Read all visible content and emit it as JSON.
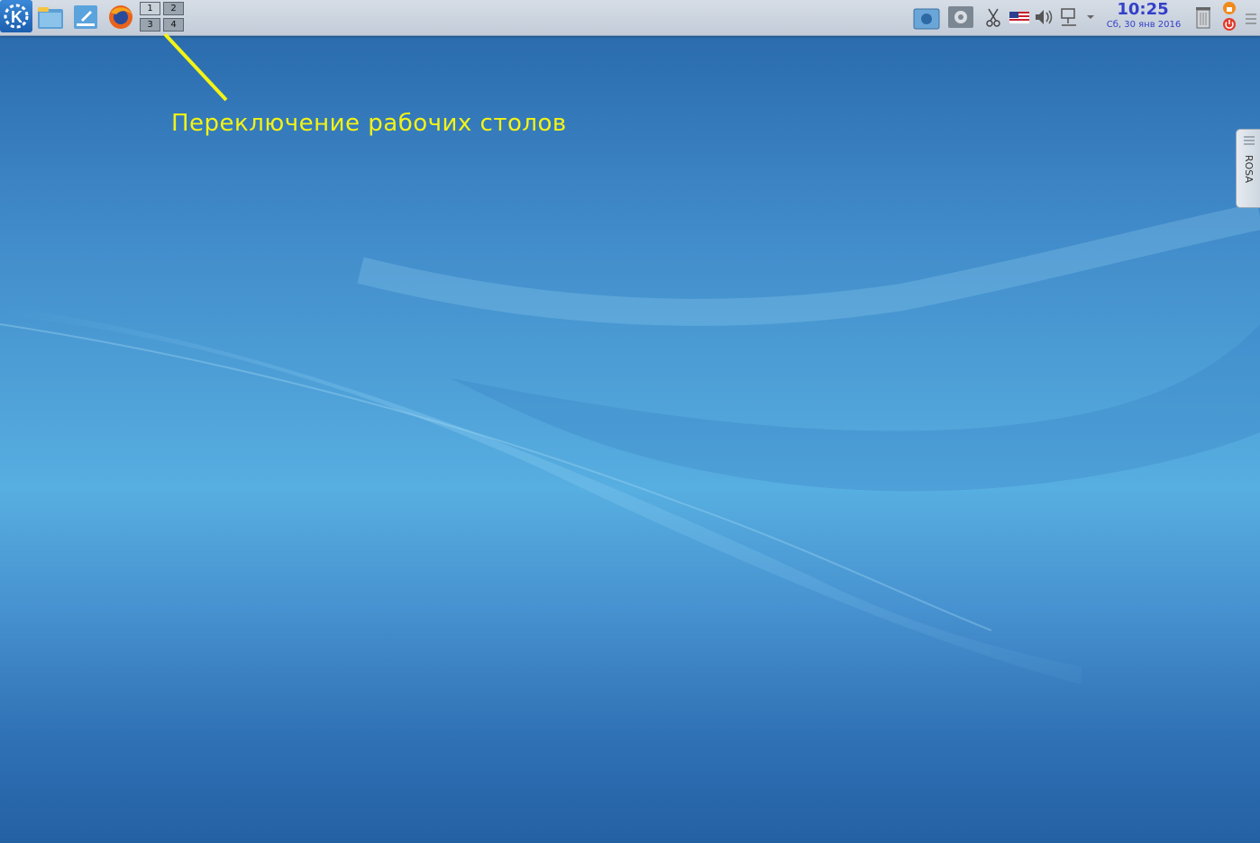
{
  "panel": {
    "launchers": [
      {
        "name": "kde-menu-icon"
      },
      {
        "name": "file-manager-icon"
      },
      {
        "name": "text-editor-icon"
      },
      {
        "name": "firefox-icon"
      }
    ],
    "pager": [
      "1",
      "2",
      "3",
      "4"
    ],
    "active_desktop": "1",
    "tray": [
      "screenshot-icon",
      "settings-icon",
      "clipboard-scissors-icon",
      "keyboard-layout-flag-icon",
      "volume-icon",
      "network-icon",
      "tray-expand-icon"
    ],
    "clock": {
      "time": "10:25",
      "date": "Сб, 30 янв 2016"
    },
    "trash_icon": "trash-icon",
    "session_icons": [
      "lock-icon",
      "power-icon"
    ]
  },
  "annotation": {
    "text": "Переключение рабочих столов",
    "color": "#f3f316"
  },
  "side_tab": {
    "label": "ROSA"
  },
  "colors": {
    "accent": "#3340c8",
    "desktop": "#3f88c8"
  }
}
